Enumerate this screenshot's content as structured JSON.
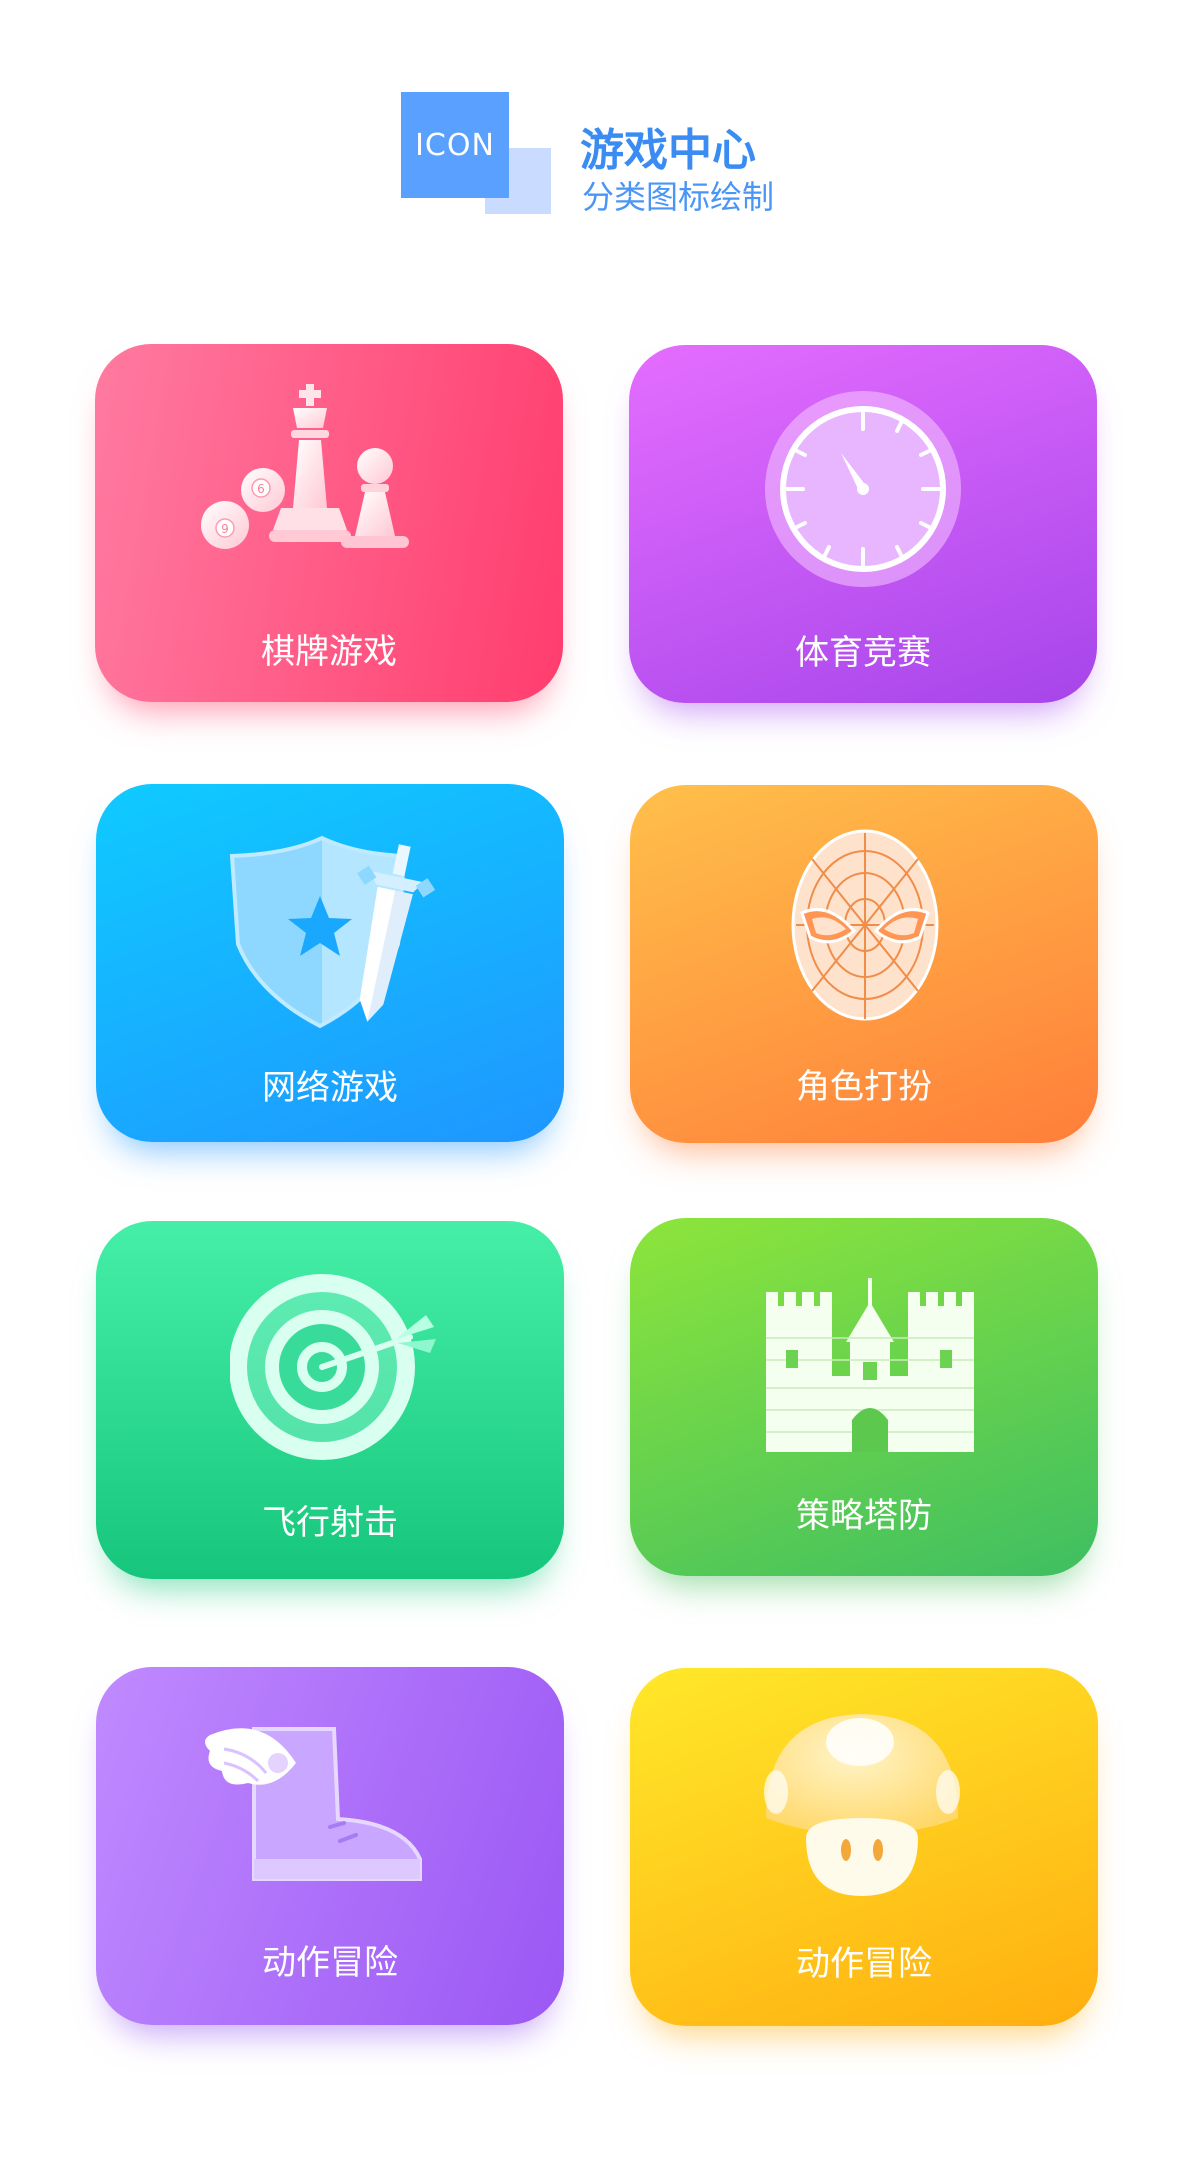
{
  "header": {
    "logo_text": "ICON",
    "title": "游戏中心",
    "subtitle": "分类图标绘制"
  },
  "cards": [
    {
      "label": "棋牌游戏",
      "icon": "chess-icon",
      "color": "#ff4f7c"
    },
    {
      "label": "体育竞赛",
      "icon": "stopwatch-icon",
      "color": "#c25af5"
    },
    {
      "label": "网络游戏",
      "icon": "shield-sword-icon",
      "color": "#1aaeff"
    },
    {
      "label": "角色打扮",
      "icon": "spiderman-mask-icon",
      "color": "#ff9a42"
    },
    {
      "label": "飞行射击",
      "icon": "target-arrow-icon",
      "color": "#22d88c"
    },
    {
      "label": "策略塔防",
      "icon": "castle-icon",
      "color": "#66d04c"
    },
    {
      "label": "动作冒险",
      "icon": "winged-boot-icon",
      "color": "#ae70f8"
    },
    {
      "label": "动作冒险",
      "icon": "mushroom-icon",
      "color": "#ffc41c"
    }
  ],
  "chess_icon_text": {
    "ball_a": "6",
    "ball_b": "9"
  }
}
